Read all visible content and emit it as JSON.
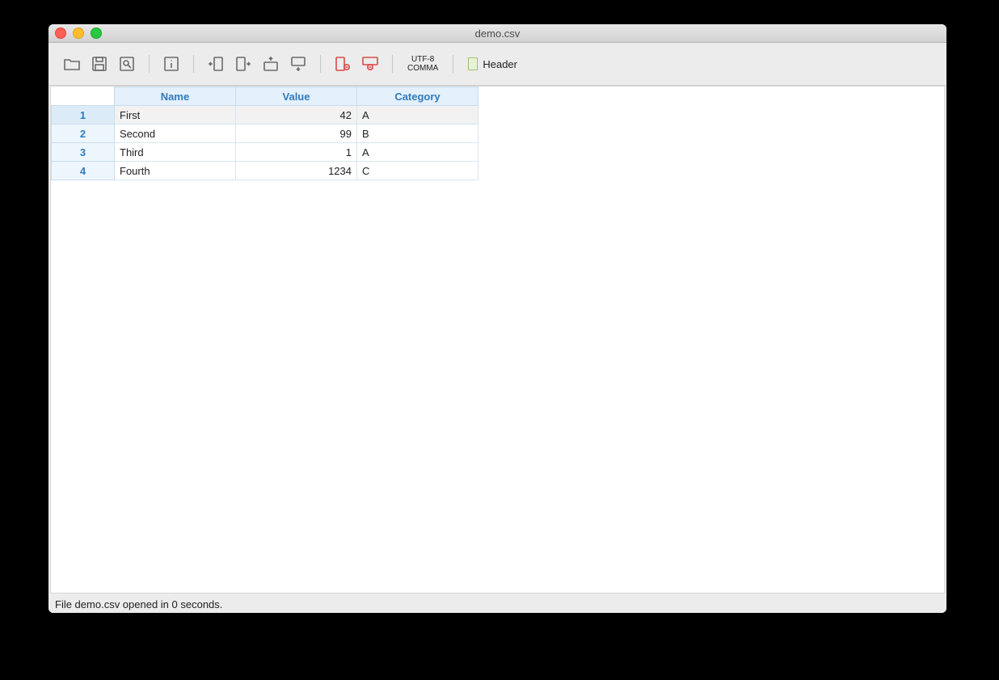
{
  "window": {
    "title": "demo.csv"
  },
  "toolbar": {
    "encoding_line1": "UTF-8",
    "encoding_line2": "COMMA",
    "header_label": "Header"
  },
  "table": {
    "columns": [
      "Name",
      "Value",
      "Category"
    ],
    "rows": [
      {
        "n": "1",
        "name": "First",
        "value": "42",
        "category": "A"
      },
      {
        "n": "2",
        "name": "Second",
        "value": "99",
        "category": "B"
      },
      {
        "n": "3",
        "name": "Third",
        "value": "1",
        "category": "A"
      },
      {
        "n": "4",
        "name": "Fourth",
        "value": "1234",
        "category": "C"
      }
    ],
    "selected_row_index": 0
  },
  "status": {
    "message": "File demo.csv opened in 0 seconds."
  }
}
